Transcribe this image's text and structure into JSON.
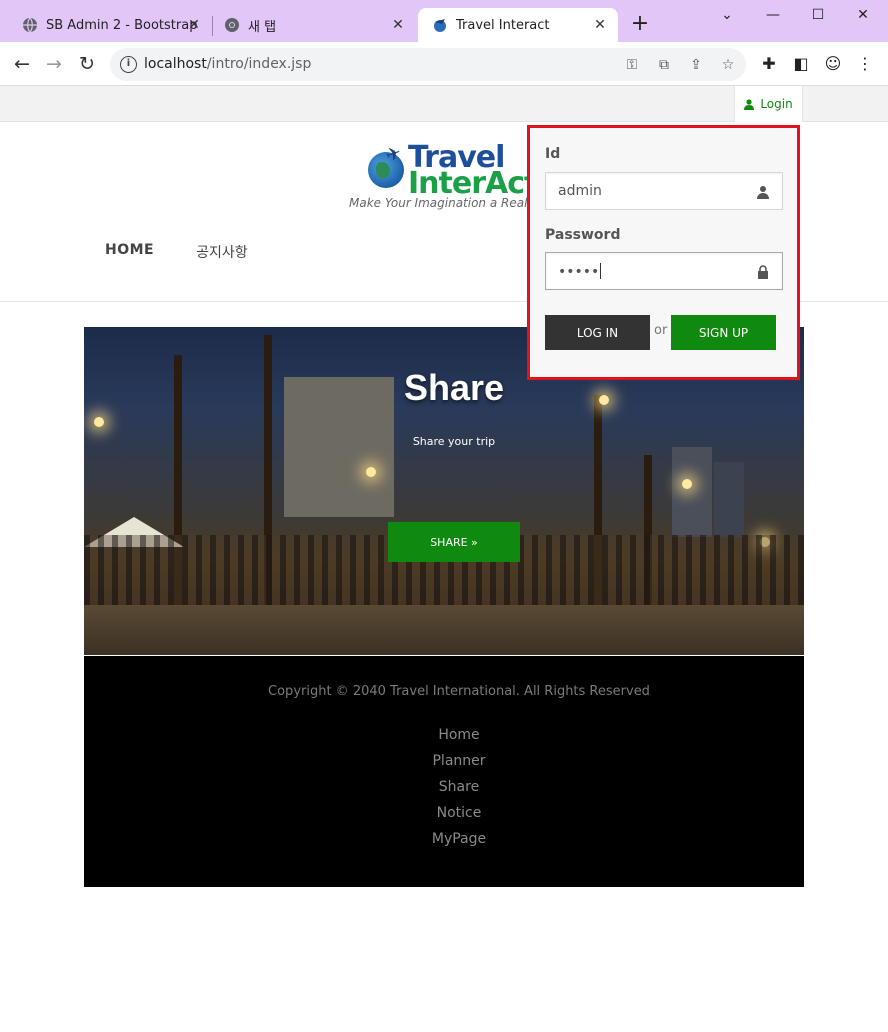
{
  "browser": {
    "tabs": [
      {
        "title": "SB Admin 2 - Bootstrap",
        "icon": "globe-icon",
        "active": false
      },
      {
        "title": "새 탭",
        "icon": "chrome-icon",
        "active": false
      },
      {
        "title": "Travel Interact",
        "icon": "site-favicon-icon",
        "active": true
      }
    ],
    "new_tab_label": "+",
    "url_host": "localhost",
    "url_path": "/intro/index.jsp"
  },
  "topbar": {
    "login_label": "Login"
  },
  "header": {
    "logo_word1": "Travel",
    "logo_word2": "InterAct",
    "tagline": "Make Your Imagination a Reali",
    "nav": [
      {
        "label": "HOME"
      },
      {
        "label": "공지사항"
      }
    ]
  },
  "hero": {
    "title": "Share",
    "subtitle": "Share your trip",
    "button_label": "SHARE »"
  },
  "footer": {
    "copyright": "Copyright © 2040 Travel International. All Rights Reserved",
    "links": [
      "Home",
      "Planner",
      "Share",
      "Notice",
      "MyPage"
    ]
  },
  "login_form": {
    "id_label": "Id",
    "id_value": "admin",
    "password_label": "Password",
    "password_value": "•••••",
    "login_button": "LOG IN",
    "or_text": "or",
    "signup_button": "SIGN UP"
  },
  "colors": {
    "accent_green": "#0f8a0f",
    "highlight_border": "#e0121d",
    "tabbar": "#e2c6f7"
  }
}
